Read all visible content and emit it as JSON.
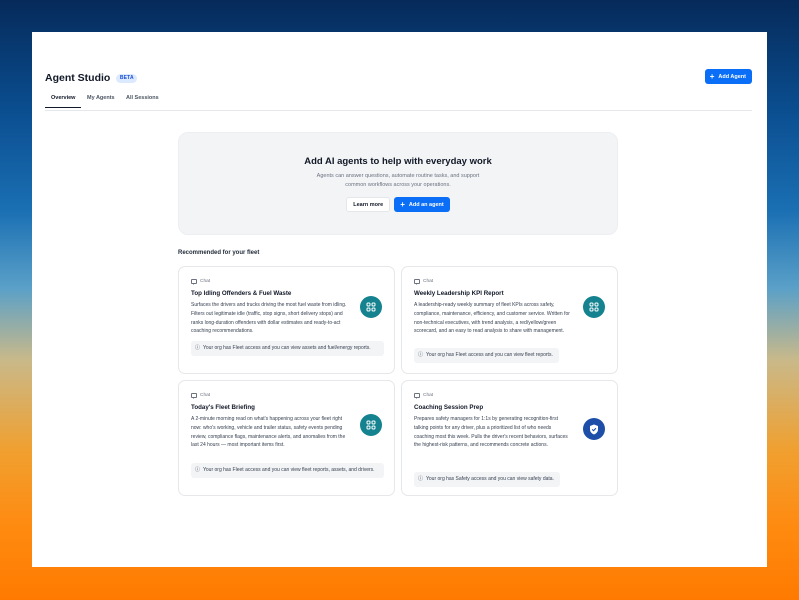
{
  "app": {
    "title": "Agent Studio",
    "badge": "BETA",
    "add_agent_label": "Add Agent",
    "accent_color": "#0b6ef7"
  },
  "tabs": [
    {
      "label": "Overview",
      "active": true
    },
    {
      "label": "My Agents",
      "active": false
    },
    {
      "label": "All Sessions",
      "active": false
    }
  ],
  "hero": {
    "title": "Add AI agents to help with everyday work",
    "subtitle": "Agents can answer questions, automate routine tasks, and support common workflows across your operations.",
    "learn_more_label": "Learn more",
    "add_agent_label": "Add an agent"
  },
  "recommended": {
    "heading": "Recommended for your fleet",
    "cards": [
      {
        "type": "Chat",
        "title": "Top Idling Offenders & Fuel Waste",
        "description": "Surfaces the drivers and trucks driving the most fuel waste from idling. Filters out legitimate idle (traffic, stop signs, short delivery stops) and ranks long-duration offenders with dollar estimates and ready-to-act coaching recommendations.",
        "icon": "chat-bubble-icon",
        "access": "Your org has Fleet access and you can view assets and fuel/energy reports."
      },
      {
        "type": "Chat",
        "title": "Weekly Leadership KPI Report",
        "description": "A leadership-ready weekly summary of fleet KPIs across safety, compliance, maintenance, efficiency, and customer service. Written for non-technical executives, with trend analysis, a red/yellow/green scorecard, and an easy to read analysis to share with management.",
        "icon": "chat-bubble-icon",
        "access": "Your org has Fleet access and you can view fleet reports."
      },
      {
        "type": "Chat",
        "title": "Today's Fleet Briefing",
        "description": "A 2-minute morning read on what's happening across your fleet right now: who's working, vehicle and trailer status, safety events pending review, compliance flags, maintenance alerts, and anomalies from the last 24 hours — most important items first.",
        "icon": "chat-bubble-icon",
        "access": "Your org has Fleet access and you can view fleet reports, assets, and drivers."
      },
      {
        "type": "Chat",
        "title": "Coaching Session Prep",
        "description": "Prepares safety managers for 1:1s by generating recognition-first talking points for any driver, plus a prioritized list of who needs coaching most this week. Pulls the driver's recent behaviors, surfaces the highest-risk patterns, and recommends concrete actions.",
        "icon": "shield-check-icon",
        "access": "Your org has Safety access and you can view safety data."
      }
    ]
  }
}
